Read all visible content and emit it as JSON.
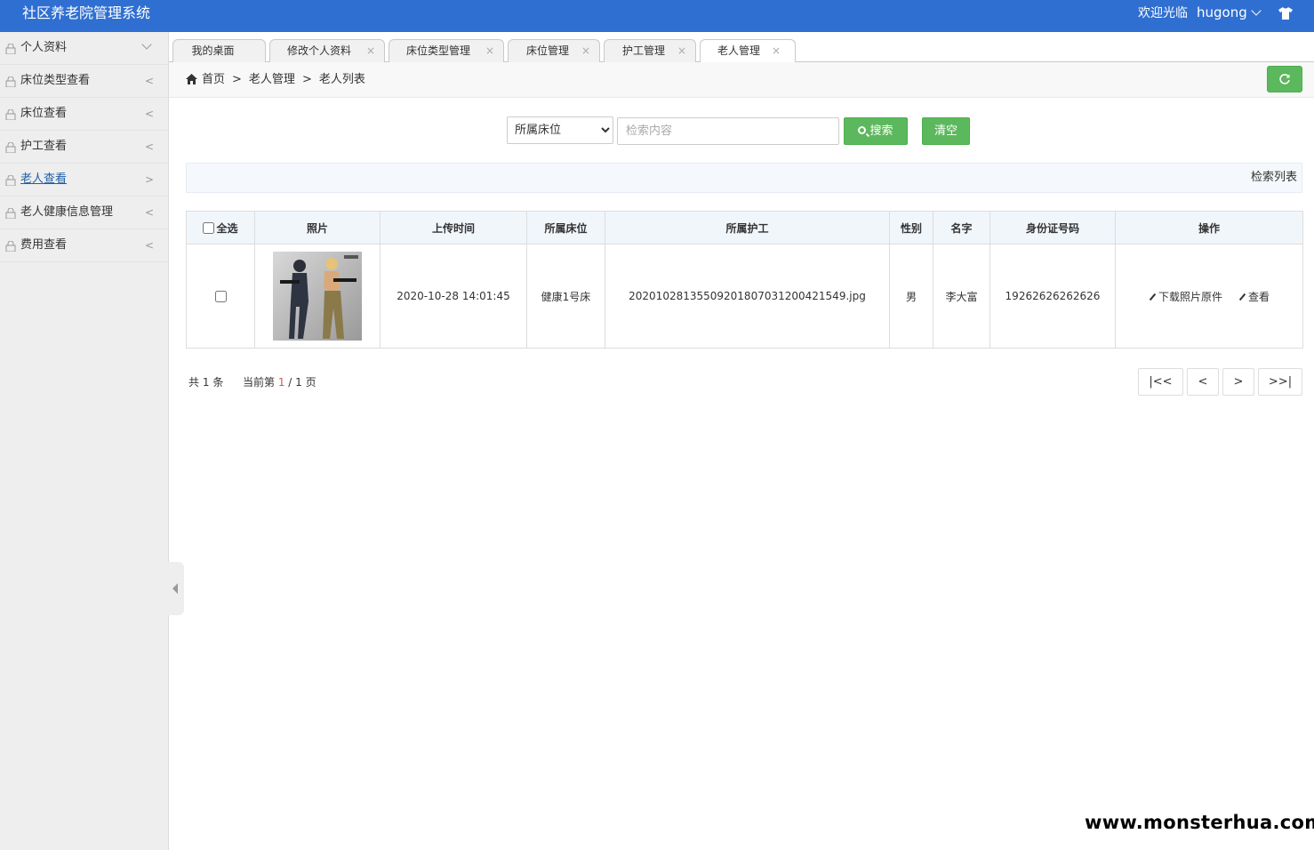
{
  "header": {
    "title": "社区养老院管理系统",
    "welcome": "欢迎光临",
    "username": "hugong"
  },
  "sidebar": {
    "items": [
      {
        "label": "个人资料",
        "expanded": true
      },
      {
        "label": "床位类型查看"
      },
      {
        "label": "床位查看"
      },
      {
        "label": "护工查看"
      },
      {
        "label": "老人查看",
        "active": true
      },
      {
        "label": "老人健康信息管理"
      },
      {
        "label": "费用查看"
      }
    ]
  },
  "tabs": [
    {
      "label": "我的桌面"
    },
    {
      "label": "修改个人资料"
    },
    {
      "label": "床位类型管理"
    },
    {
      "label": "床位管理"
    },
    {
      "label": "护工管理"
    },
    {
      "label": "老人管理",
      "active": true
    }
  ],
  "breadcrumb": {
    "home": "首页",
    "level1": "老人管理",
    "level2": "老人列表",
    "sep": ">"
  },
  "search": {
    "select_value": "所属床位",
    "placeholder": "检索内容",
    "search_label": "搜索",
    "clear_label": "清空"
  },
  "list": {
    "title": "检索列表"
  },
  "table": {
    "select_all": "全选",
    "columns": [
      "照片",
      "上传时间",
      "所属床位",
      "所属护工",
      "性别",
      "名字",
      "身份证号码",
      "操作"
    ],
    "rows": [
      {
        "upload_time": "2020-10-28 14:01:45",
        "bed": "健康1号床",
        "caregiver": "20201028135509201807031200421549.jpg",
        "gender": "男",
        "name": "李大富",
        "id_number": "19262626262626",
        "op_download": "下载照片原件",
        "op_view": "查看"
      }
    ]
  },
  "pager": {
    "total_prefix": "共",
    "total": "1",
    "total_suffix": "条",
    "current_prefix": "当前第",
    "current": "1",
    "slash": "/",
    "pages": "1",
    "pages_suffix": "页",
    "first": "|<<",
    "prev": "<",
    "next": ">",
    "last": ">>|"
  },
  "watermark": "www.monsterhua.com",
  "colors": {
    "header_bg": "#2f6fd1",
    "button_green": "#5cb85c",
    "sidebar_bg": "#eeeeee",
    "active_link": "#1e5fa8",
    "current_page": "#d9534f"
  }
}
